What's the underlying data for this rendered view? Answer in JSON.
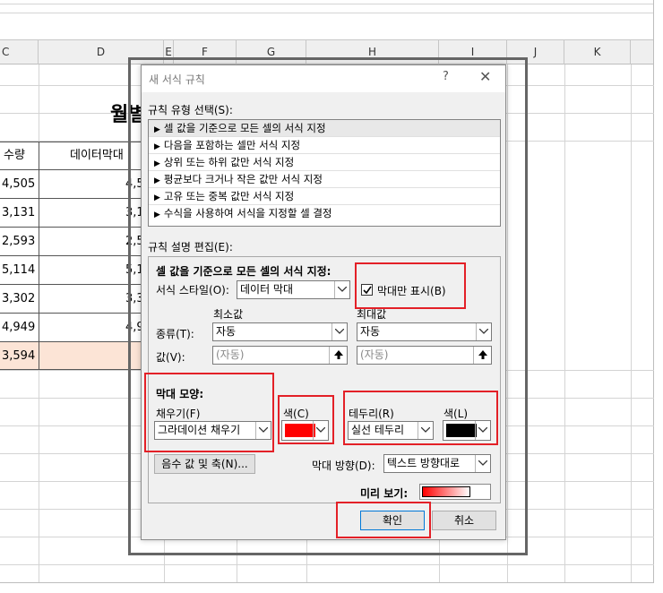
{
  "sheet": {
    "columns": [
      "C",
      "D",
      "E",
      "F",
      "G",
      "H",
      "I",
      "J",
      "K"
    ],
    "title_fragment": "월별",
    "header_quantity": "수량",
    "header_databar": "데이터막대",
    "quantities": [
      "4,505",
      "3,131",
      "2,593",
      "5,114",
      "3,302",
      "4,949",
      "3,594"
    ],
    "databar_fragments": [
      "4,5",
      "3,1",
      "2,5",
      "5,1",
      "3,3",
      "4,9",
      ""
    ]
  },
  "dialog": {
    "title": "새 서식 규칙",
    "help": "?",
    "close": "✕",
    "rule_type_label": "규칙 유형 선택(S):",
    "rule_types": [
      "셀 값을 기준으로 모든 셀의 서식 지정",
      "다음을 포함하는 셀만 서식 지정",
      "상위 또는 하위 값만 서식 지정",
      "평균보다 크거나 작은 값만 서식 지정",
      "고유 또는 중복 값만 서식 지정",
      "수식을 사용하여 서식을 지정할 셀 결정"
    ],
    "edit_label": "규칙 설명 편집(E):",
    "section_title": "셀 값을 기준으로 모든 셀의 서식 지정:",
    "format_style_label": "서식 스타일(O):",
    "format_style_value": "데이터 막대",
    "bar_only_label": "막대만 표시(B)",
    "min_label": "최소값",
    "max_label": "최대값",
    "type_label": "종류(T):",
    "min_type": "자동",
    "max_type": "자동",
    "value_label": "값(V):",
    "min_value": "(자동)",
    "max_value": "(자동)",
    "bar_shape_label": "막대 모양:",
    "fill_label": "채우기(F)",
    "fill_value": "그라데이션 채우기",
    "color_label": "색(C)",
    "fill_color": "#ff0000",
    "border_label": "테두리(R)",
    "border_value": "실선 테두리",
    "border_color_label": "색(L)",
    "border_color": "#000000",
    "negative_button": "음수 값 및 축(N)...",
    "direction_label": "막대 방향(D):",
    "direction_value": "텍스트 방향대로",
    "preview_label": "미리 보기:",
    "ok": "확인",
    "cancel": "취소"
  }
}
